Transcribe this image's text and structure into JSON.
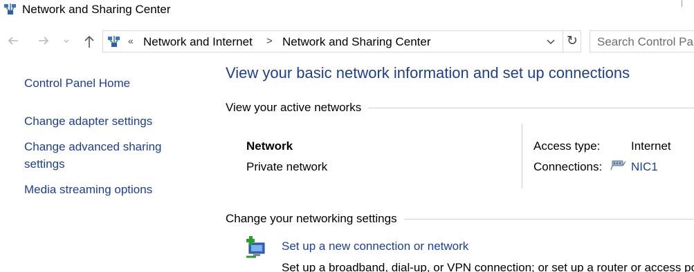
{
  "window": {
    "title": "Network and Sharing Center"
  },
  "nav": {
    "back_icon": "arrow-left-icon",
    "forward_icon": "arrow-right-icon",
    "recent_icon": "chevron-down-icon",
    "up_icon": "arrow-up-icon"
  },
  "address": {
    "overflow": "«",
    "crumbs": [
      "Network and Internet",
      "Network and Sharing Center"
    ],
    "separator": ">",
    "dropdown": "⌄",
    "refresh": "↻"
  },
  "search": {
    "placeholder": "Search Control Panel"
  },
  "sidebar": {
    "home": "Control Panel Home",
    "items": [
      {
        "label": "Change adapter settings"
      },
      {
        "label": "Change advanced sharing settings"
      },
      {
        "label": "Media streaming options"
      }
    ]
  },
  "main": {
    "heading": "View your basic network information and set up connections",
    "active_section": "View your active networks",
    "network": {
      "name": "Network",
      "type": "Private network",
      "access_label": "Access type:",
      "access_value": "Internet",
      "connections_label": "Connections:",
      "connection_name": "NIC1"
    },
    "settings_section": "Change your networking settings",
    "setup": {
      "link": "Set up a new connection or network",
      "description": "Set up a broadband, dial-up, or VPN connection; or set up a router or access point."
    }
  },
  "colors": {
    "link": "#1c3f94",
    "heading": "#1e3e8f",
    "divider": "#d0d0d0"
  }
}
